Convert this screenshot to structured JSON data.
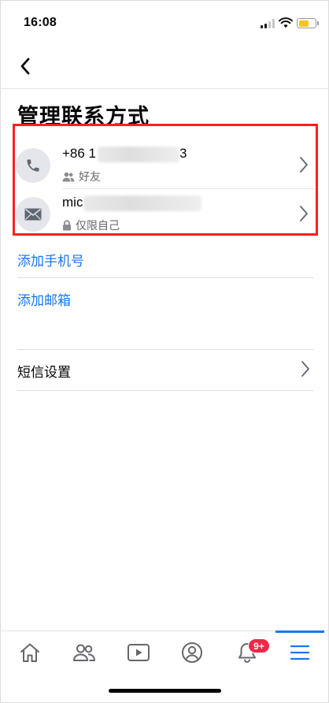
{
  "status_bar": {
    "time": "16:08"
  },
  "header": {
    "title": "管理联系方式"
  },
  "contacts": [
    {
      "type": "phone",
      "value_prefix": "+86 1",
      "value_suffix": "3",
      "audience": "好友",
      "audience_icon": "friends-icon"
    },
    {
      "type": "email",
      "value_prefix": "mic",
      "value_suffix": "",
      "audience": "仅限自己",
      "audience_icon": "lock-icon"
    }
  ],
  "links": {
    "add_phone": "添加手机号",
    "add_email": "添加邮箱"
  },
  "settings": {
    "sms_settings": "短信设置"
  },
  "tab_bar": {
    "tabs": [
      "home-icon",
      "friends-icon",
      "watch-icon",
      "profile-icon",
      "notifications-icon",
      "menu-icon"
    ],
    "active": "menu-icon",
    "notification_badge": "9+"
  },
  "colors": {
    "accent": "#1877f2",
    "highlight": "#ff1f1f",
    "badge": "#f02849"
  }
}
